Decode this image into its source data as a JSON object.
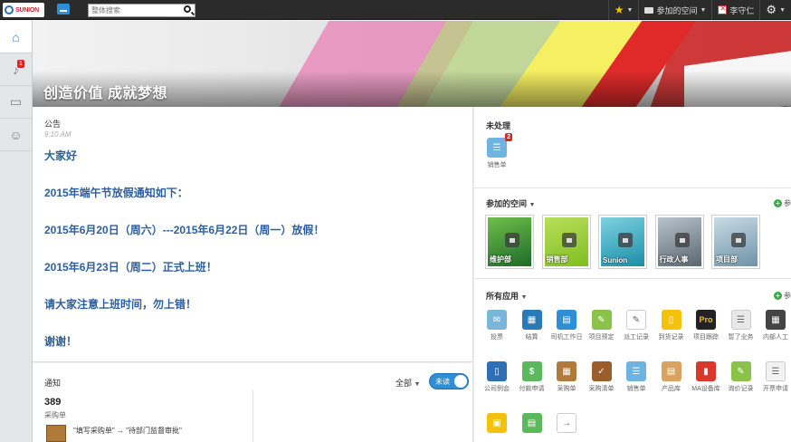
{
  "header": {
    "logo_text": "SUNION",
    "search_placeholder": "整体搜索",
    "spaces_label": "参加的空间",
    "user_name": "李守仁"
  },
  "rail": {
    "notification_count": "1"
  },
  "banner": {
    "title": "创造价值 成就梦想"
  },
  "announcement": {
    "label": "公告",
    "time": "9:10 AM",
    "lines": [
      "大家好",
      "2015年端午节放假通知如下：",
      "2015年6月20日（周六）---2015年6月22日（周一）放假！",
      "2015年6月23日（周二）正式上班！",
      "请大家注意上班时间，勿上错！",
      "谢谢！"
    ]
  },
  "notice": {
    "title": "通知",
    "filter_label": "全部",
    "toggle_label": "未读",
    "count": "389",
    "sub_label": "采购单",
    "flow_text": "\"填写采购单\" → \"待部门监督审批\""
  },
  "pending": {
    "title": "未处理",
    "app_label": "销售单",
    "badge": "2"
  },
  "spaces": {
    "title": "参加的空间",
    "more_label": "参",
    "items": [
      {
        "name": "维护部",
        "color1": "#1d6b2a",
        "color2": "#6fbf4a"
      },
      {
        "name": "销售部",
        "color1": "#7fbf1f",
        "color2": "#b9de5c"
      },
      {
        "name": "Sunion",
        "color1": "#1a8fa8",
        "color2": "#7fd1e0"
      },
      {
        "name": "行政人事",
        "color1": "#5a6770",
        "color2": "#b8c4cc"
      },
      {
        "name": "项目部",
        "color1": "#6f93a8",
        "color2": "#c9dbe6"
      }
    ]
  },
  "apps": {
    "title": "所有应用",
    "more_label": "参",
    "items": [
      {
        "label": "投票",
        "color": "#7ab6d9",
        "glyph": "✉"
      },
      {
        "label": "结算",
        "color": "#2a7ab8",
        "glyph": "▦"
      },
      {
        "label": "司机工作日",
        "color": "#2f8fd6",
        "glyph": "▤"
      },
      {
        "label": "项目预定",
        "color": "#8bc34a",
        "glyph": "✎"
      },
      {
        "label": "派工记录",
        "color": "#ffffff",
        "glyph": "✎"
      },
      {
        "label": "到货记录",
        "color": "#f4c20d",
        "glyph": "▯"
      },
      {
        "label": "项目跟踪",
        "color": "#222222",
        "glyph": "Pro"
      },
      {
        "label": "暂了业务",
        "color": "#e8e8e8",
        "glyph": "☰"
      },
      {
        "label": "内部人工",
        "color": "#444444",
        "glyph": "▦"
      },
      {
        "label": "公司例会",
        "color": "#2f6fb5",
        "glyph": "▯"
      },
      {
        "label": "付款申请",
        "color": "#5cb85c",
        "glyph": "$"
      },
      {
        "label": "采购单",
        "color": "#b07a3a",
        "glyph": "▦"
      },
      {
        "label": "采购清单",
        "color": "#9b5d2b",
        "glyph": "✓"
      },
      {
        "label": "销售单",
        "color": "#6fb3e0",
        "glyph": "☰"
      },
      {
        "label": "产品库",
        "color": "#d9a35f",
        "glyph": "▤"
      },
      {
        "label": "MA设备库",
        "color": "#d9392b",
        "glyph": "▮"
      },
      {
        "label": "询价记录",
        "color": "#8bc34a",
        "glyph": "✎"
      },
      {
        "label": "开票申请",
        "color": "#f2f2f2",
        "glyph": "☰"
      },
      {
        "label": "",
        "color": "#f4c20d",
        "glyph": "▣"
      },
      {
        "label": "",
        "color": "#5cb85c",
        "glyph": "▤"
      },
      {
        "label": "",
        "color": "#ffffff",
        "glyph": "→"
      }
    ]
  }
}
